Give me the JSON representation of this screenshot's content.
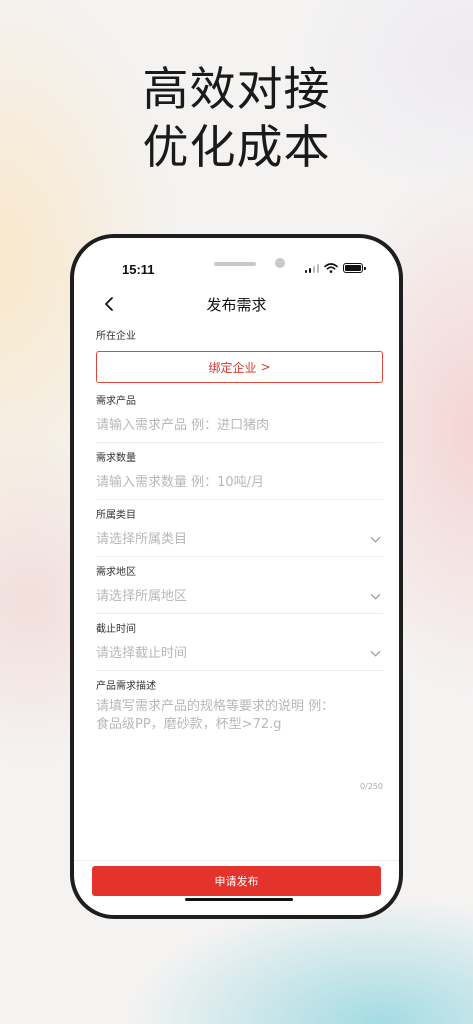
{
  "headline": {
    "line1": "高效对接",
    "line2": "优化成本"
  },
  "status_bar": {
    "time": "15:11"
  },
  "nav": {
    "title": "发布需求"
  },
  "form": {
    "company": {
      "label": "所在企业",
      "button_label": "绑定企业",
      "button_chevron": ">"
    },
    "product": {
      "label": "需求产品",
      "placeholder": "请输入需求产品 例：进口猪肉"
    },
    "quantity": {
      "label": "需求数量",
      "placeholder": "请输入需求数量 例：10吨/月"
    },
    "category": {
      "label": "所属类目",
      "placeholder": "请选择所属类目"
    },
    "region": {
      "label": "需求地区",
      "placeholder": "请选择所属地区"
    },
    "deadline": {
      "label": "截止时间",
      "placeholder": "请选择截止时间"
    },
    "description": {
      "label": "产品需求描述",
      "placeholder_line1": "请填写需求产品的规格等要求的说明 例：",
      "placeholder_line2": "食品级PP，磨砂款，杯型>72.g",
      "counter": "0/250"
    }
  },
  "submit_label": "申请发布",
  "colors": {
    "accent": "#e3332a",
    "text": "#111111",
    "placeholder": "#b8b8b8"
  },
  "icons": [
    "back-chevron-icon",
    "signal-icon",
    "wifi-icon",
    "battery-icon",
    "dropdown-chevron-icon"
  ]
}
